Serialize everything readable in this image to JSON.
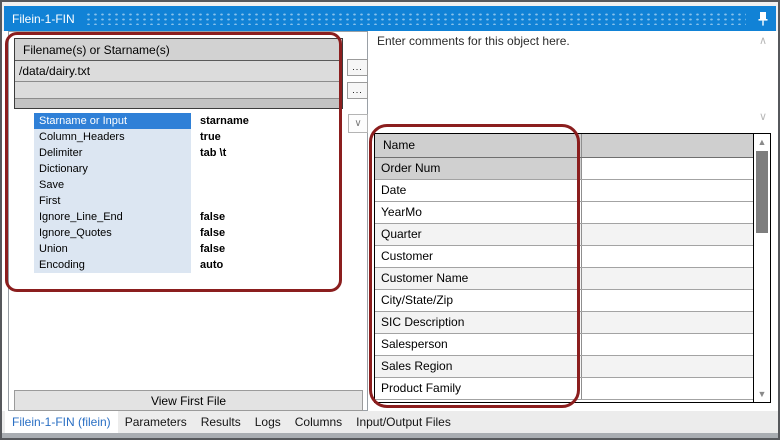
{
  "window": {
    "title": "Filein-1-FIN"
  },
  "icons": {
    "combo_chevron": "∨",
    "scroll_up_thin": "∧",
    "scroll_down_thin": "∨",
    "scroll_up": "▲",
    "scroll_down": "▼"
  },
  "filename_panel": {
    "header": "Filename(s) or Starname(s)",
    "rows": [
      "/data/dairy.txt",
      ""
    ],
    "browse_label": "..."
  },
  "property_grid": {
    "rows": [
      {
        "label": "Starname or Input",
        "value": "starname",
        "selected": true
      },
      {
        "label": "Column_Headers",
        "value": "true"
      },
      {
        "label": "Delimiter",
        "value": "tab \\t"
      },
      {
        "label": "Dictionary",
        "value": ""
      },
      {
        "label": "Save",
        "value": ""
      },
      {
        "label": "First",
        "value": ""
      },
      {
        "label": "Ignore_Line_End",
        "value": "false"
      },
      {
        "label": "Ignore_Quotes",
        "value": "false"
      },
      {
        "label": "Union",
        "value": "false"
      },
      {
        "label": "Encoding",
        "value": "auto"
      }
    ]
  },
  "buttons": {
    "view_first_file": "View First File"
  },
  "comments": {
    "text": "Enter comments for this object here."
  },
  "columns_table": {
    "header": "Name",
    "rows": [
      {
        "name": "Order Num",
        "selected": true
      },
      {
        "name": "Date"
      },
      {
        "name": "YearMo"
      },
      {
        "name": "Quarter",
        "shaded": true
      },
      {
        "name": "Customer"
      },
      {
        "name": "Customer Name",
        "shaded": true
      },
      {
        "name": "City/State/Zip"
      },
      {
        "name": "SIC Description",
        "shaded": true
      },
      {
        "name": "Salesperson"
      },
      {
        "name": "Sales Region",
        "shaded": true
      },
      {
        "name": "Product Family"
      }
    ]
  },
  "tabs": [
    {
      "label": "Filein-1-FIN (filein)",
      "active": true
    },
    {
      "label": "Parameters"
    },
    {
      "label": "Results"
    },
    {
      "label": "Logs"
    },
    {
      "label": "Columns"
    },
    {
      "label": "Input/Output Files"
    }
  ],
  "colors": {
    "titlebar_blue": "#1182d6",
    "annotation_red": "#8b1e1e",
    "selection_blue": "#2f80d7",
    "active_tab_text": "#2a6fc4"
  }
}
